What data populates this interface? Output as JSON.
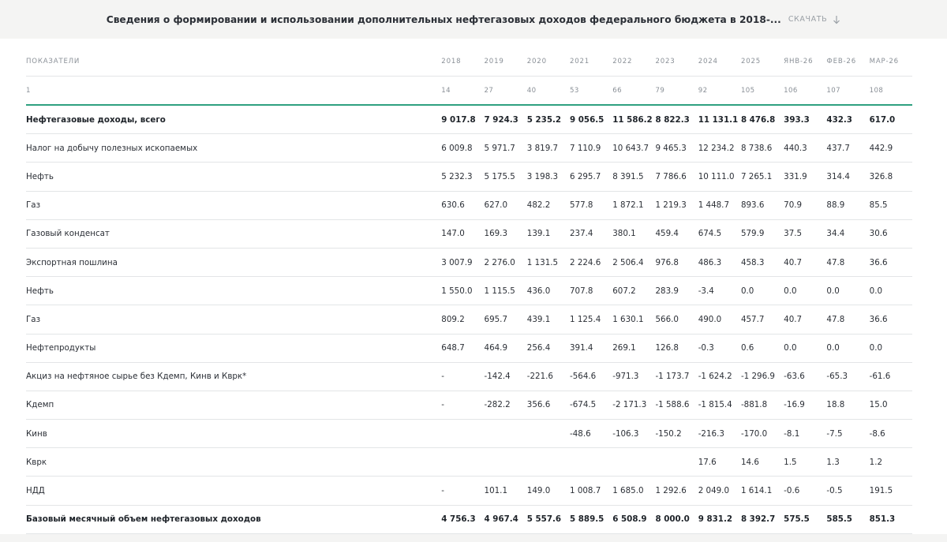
{
  "header": {
    "title": "Сведения о формировании и использовании дополнительных нефтегазовых доходов федерального бюджета в 2018-...",
    "download_label": "СКАЧАТЬ",
    "download_icon": "arrow-down-icon"
  },
  "table": {
    "label_header": "ПОКАЗАТЕЛИ",
    "columns": [
      "2018",
      "2019",
      "2020",
      "2021",
      "2022",
      "2023",
      "2024",
      "2025",
      "ЯНВ-26",
      "ФЕВ-26",
      "МАР-26"
    ],
    "index_row": {
      "label": "1",
      "values": [
        "14",
        "27",
        "40",
        "53",
        "66",
        "79",
        "92",
        "105",
        "106",
        "107",
        "108"
      ]
    },
    "rows": [
      {
        "label": "Нефтегазовые доходы, всего",
        "bold": true,
        "values": [
          "9 017.8",
          "7 924.3",
          "5 235.2",
          "9 056.5",
          "11 586.2",
          "8 822.3",
          "11 131.1",
          "8 476.8",
          "393.3",
          "432.3",
          "617.0"
        ]
      },
      {
        "label": "Налог на добычу полезных ископаемых",
        "bold": false,
        "values": [
          "6 009.8",
          "5 971.7",
          "3 819.7",
          "7 110.9",
          "10 643.7",
          "9 465.3",
          "12 234.2",
          "8 738.6",
          "440.3",
          "437.7",
          "442.9"
        ]
      },
      {
        "label": "Нефть",
        "bold": false,
        "values": [
          "5 232.3",
          "5 175.5",
          "3 198.3",
          "6 295.7",
          "8 391.5",
          "7 786.6",
          "10 111.0",
          "7 265.1",
          "331.9",
          "314.4",
          "326.8"
        ]
      },
      {
        "label": "Газ",
        "bold": false,
        "values": [
          "630.6",
          "627.0",
          "482.2",
          "577.8",
          "1 872.1",
          "1 219.3",
          "1 448.7",
          "893.6",
          "70.9",
          "88.9",
          "85.5"
        ]
      },
      {
        "label": "Газовый конденсат",
        "bold": false,
        "values": [
          "147.0",
          "169.3",
          "139.1",
          "237.4",
          "380.1",
          "459.4",
          "674.5",
          "579.9",
          "37.5",
          "34.4",
          "30.6"
        ]
      },
      {
        "label": "Экспортная пошлина",
        "bold": false,
        "values": [
          "3 007.9",
          "2 276.0",
          "1 131.5",
          "2 224.6",
          "2 506.4",
          "976.8",
          "486.3",
          "458.3",
          "40.7",
          "47.8",
          "36.6"
        ]
      },
      {
        "label": "Нефть",
        "bold": false,
        "values": [
          "1 550.0",
          "1 115.5",
          "436.0",
          "707.8",
          "607.2",
          "283.9",
          "-3.4",
          "0.0",
          "0.0",
          "0.0",
          "0.0"
        ]
      },
      {
        "label": "Газ",
        "bold": false,
        "values": [
          "809.2",
          "695.7",
          "439.1",
          "1 125.4",
          "1 630.1",
          "566.0",
          "490.0",
          "457.7",
          "40.7",
          "47.8",
          "36.6"
        ]
      },
      {
        "label": "Нефтепродукты",
        "bold": false,
        "values": [
          "648.7",
          "464.9",
          "256.4",
          "391.4",
          "269.1",
          "126.8",
          "-0.3",
          "0.6",
          "0.0",
          "0.0",
          "0.0"
        ]
      },
      {
        "label": "Акциз на нефтяное сырье без Кдемп, Кинв и Кврк*",
        "bold": false,
        "values": [
          "-",
          "-142.4",
          "-221.6",
          "-564.6",
          "-971.3",
          "-1 173.7",
          "-1 624.2",
          "-1 296.9",
          "-63.6",
          "-65.3",
          "-61.6"
        ]
      },
      {
        "label": "Кдемп",
        "bold": false,
        "values": [
          "-",
          "-282.2",
          "356.6",
          "-674.5",
          "-2 171.3",
          "-1 588.6",
          "-1 815.4",
          "-881.8",
          "-16.9",
          "18.8",
          "15.0"
        ]
      },
      {
        "label": "Кинв",
        "bold": false,
        "values": [
          "",
          "",
          "",
          "-48.6",
          "-106.3",
          "-150.2",
          "-216.3",
          "-170.0",
          "-8.1",
          "-7.5",
          "-8.6"
        ]
      },
      {
        "label": "Кврк",
        "bold": false,
        "values": [
          "",
          "",
          "",
          "",
          "",
          "",
          "17.6",
          "14.6",
          "1.5",
          "1.3",
          "1.2"
        ]
      },
      {
        "label": "НДД",
        "bold": false,
        "values": [
          "-",
          "101.1",
          "149.0",
          "1 008.7",
          "1 685.0",
          "1 292.6",
          "2 049.0",
          "1 614.1",
          "-0.6",
          "-0.5",
          "191.5"
        ]
      },
      {
        "label": "Базовый месячный объем нефтегазовых доходов",
        "bold": true,
        "values": [
          "4 756.3",
          "4 967.4",
          "5 557.6",
          "5 889.5",
          "6 508.9",
          "8 000.0",
          "9 831.2",
          "8 392.7",
          "575.5",
          "585.5",
          "851.3"
        ]
      }
    ]
  },
  "colors": {
    "accent_line": "#2ea080",
    "topbar_bg": "#f4f4f3",
    "muted_text": "#8a9097",
    "row_divider": "#e3e5e7"
  }
}
